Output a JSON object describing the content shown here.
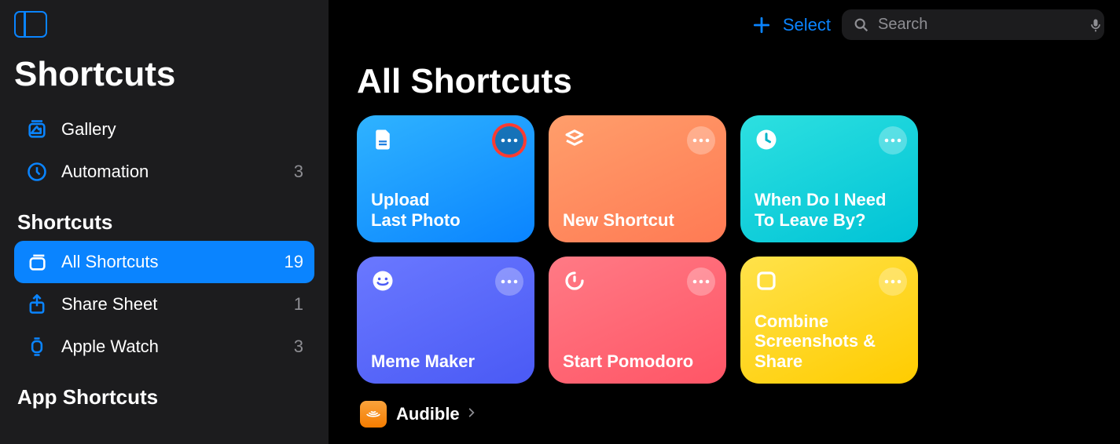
{
  "sidebar": {
    "app_title": "Shortcuts",
    "section_a": [
      {
        "label": "Gallery"
      },
      {
        "label": "Automation",
        "count": "3"
      }
    ],
    "section_b_header": "Shortcuts",
    "section_b": [
      {
        "label": "All Shortcuts",
        "count": "19",
        "selected": true
      },
      {
        "label": "Share Sheet",
        "count": "1"
      },
      {
        "label": "Apple Watch",
        "count": "3"
      }
    ],
    "section_c_header": "App Shortcuts"
  },
  "topbar": {
    "select_label": "Select",
    "search_placeholder": "Search"
  },
  "main": {
    "page_title": "All Shortcuts",
    "cards": [
      {
        "title": "Upload\nLast Photo",
        "color_a": "#2fb3ff",
        "color_b": "#0a84ff",
        "icon": "document",
        "highlight_more": true
      },
      {
        "title": "New Shortcut",
        "color_a": "#ff9e6b",
        "color_b": "#ff7a54",
        "icon": "stack"
      },
      {
        "title": "When Do I Need To Leave By?",
        "color_a": "#2de0e0",
        "color_b": "#00c3d6",
        "icon": "clock"
      },
      {
        "title": "Meme Maker",
        "color_a": "#6a78ff",
        "color_b": "#4a5af5",
        "icon": "smile"
      },
      {
        "title": "Start Pomodoro",
        "color_a": "#ff7a85",
        "color_b": "#ff5566",
        "icon": "timer"
      },
      {
        "title": "Combine Screenshots & Share",
        "color_a": "#ffe24a",
        "color_b": "#ffcc00",
        "icon": "square"
      }
    ],
    "app_section": {
      "label": "Audible"
    }
  }
}
